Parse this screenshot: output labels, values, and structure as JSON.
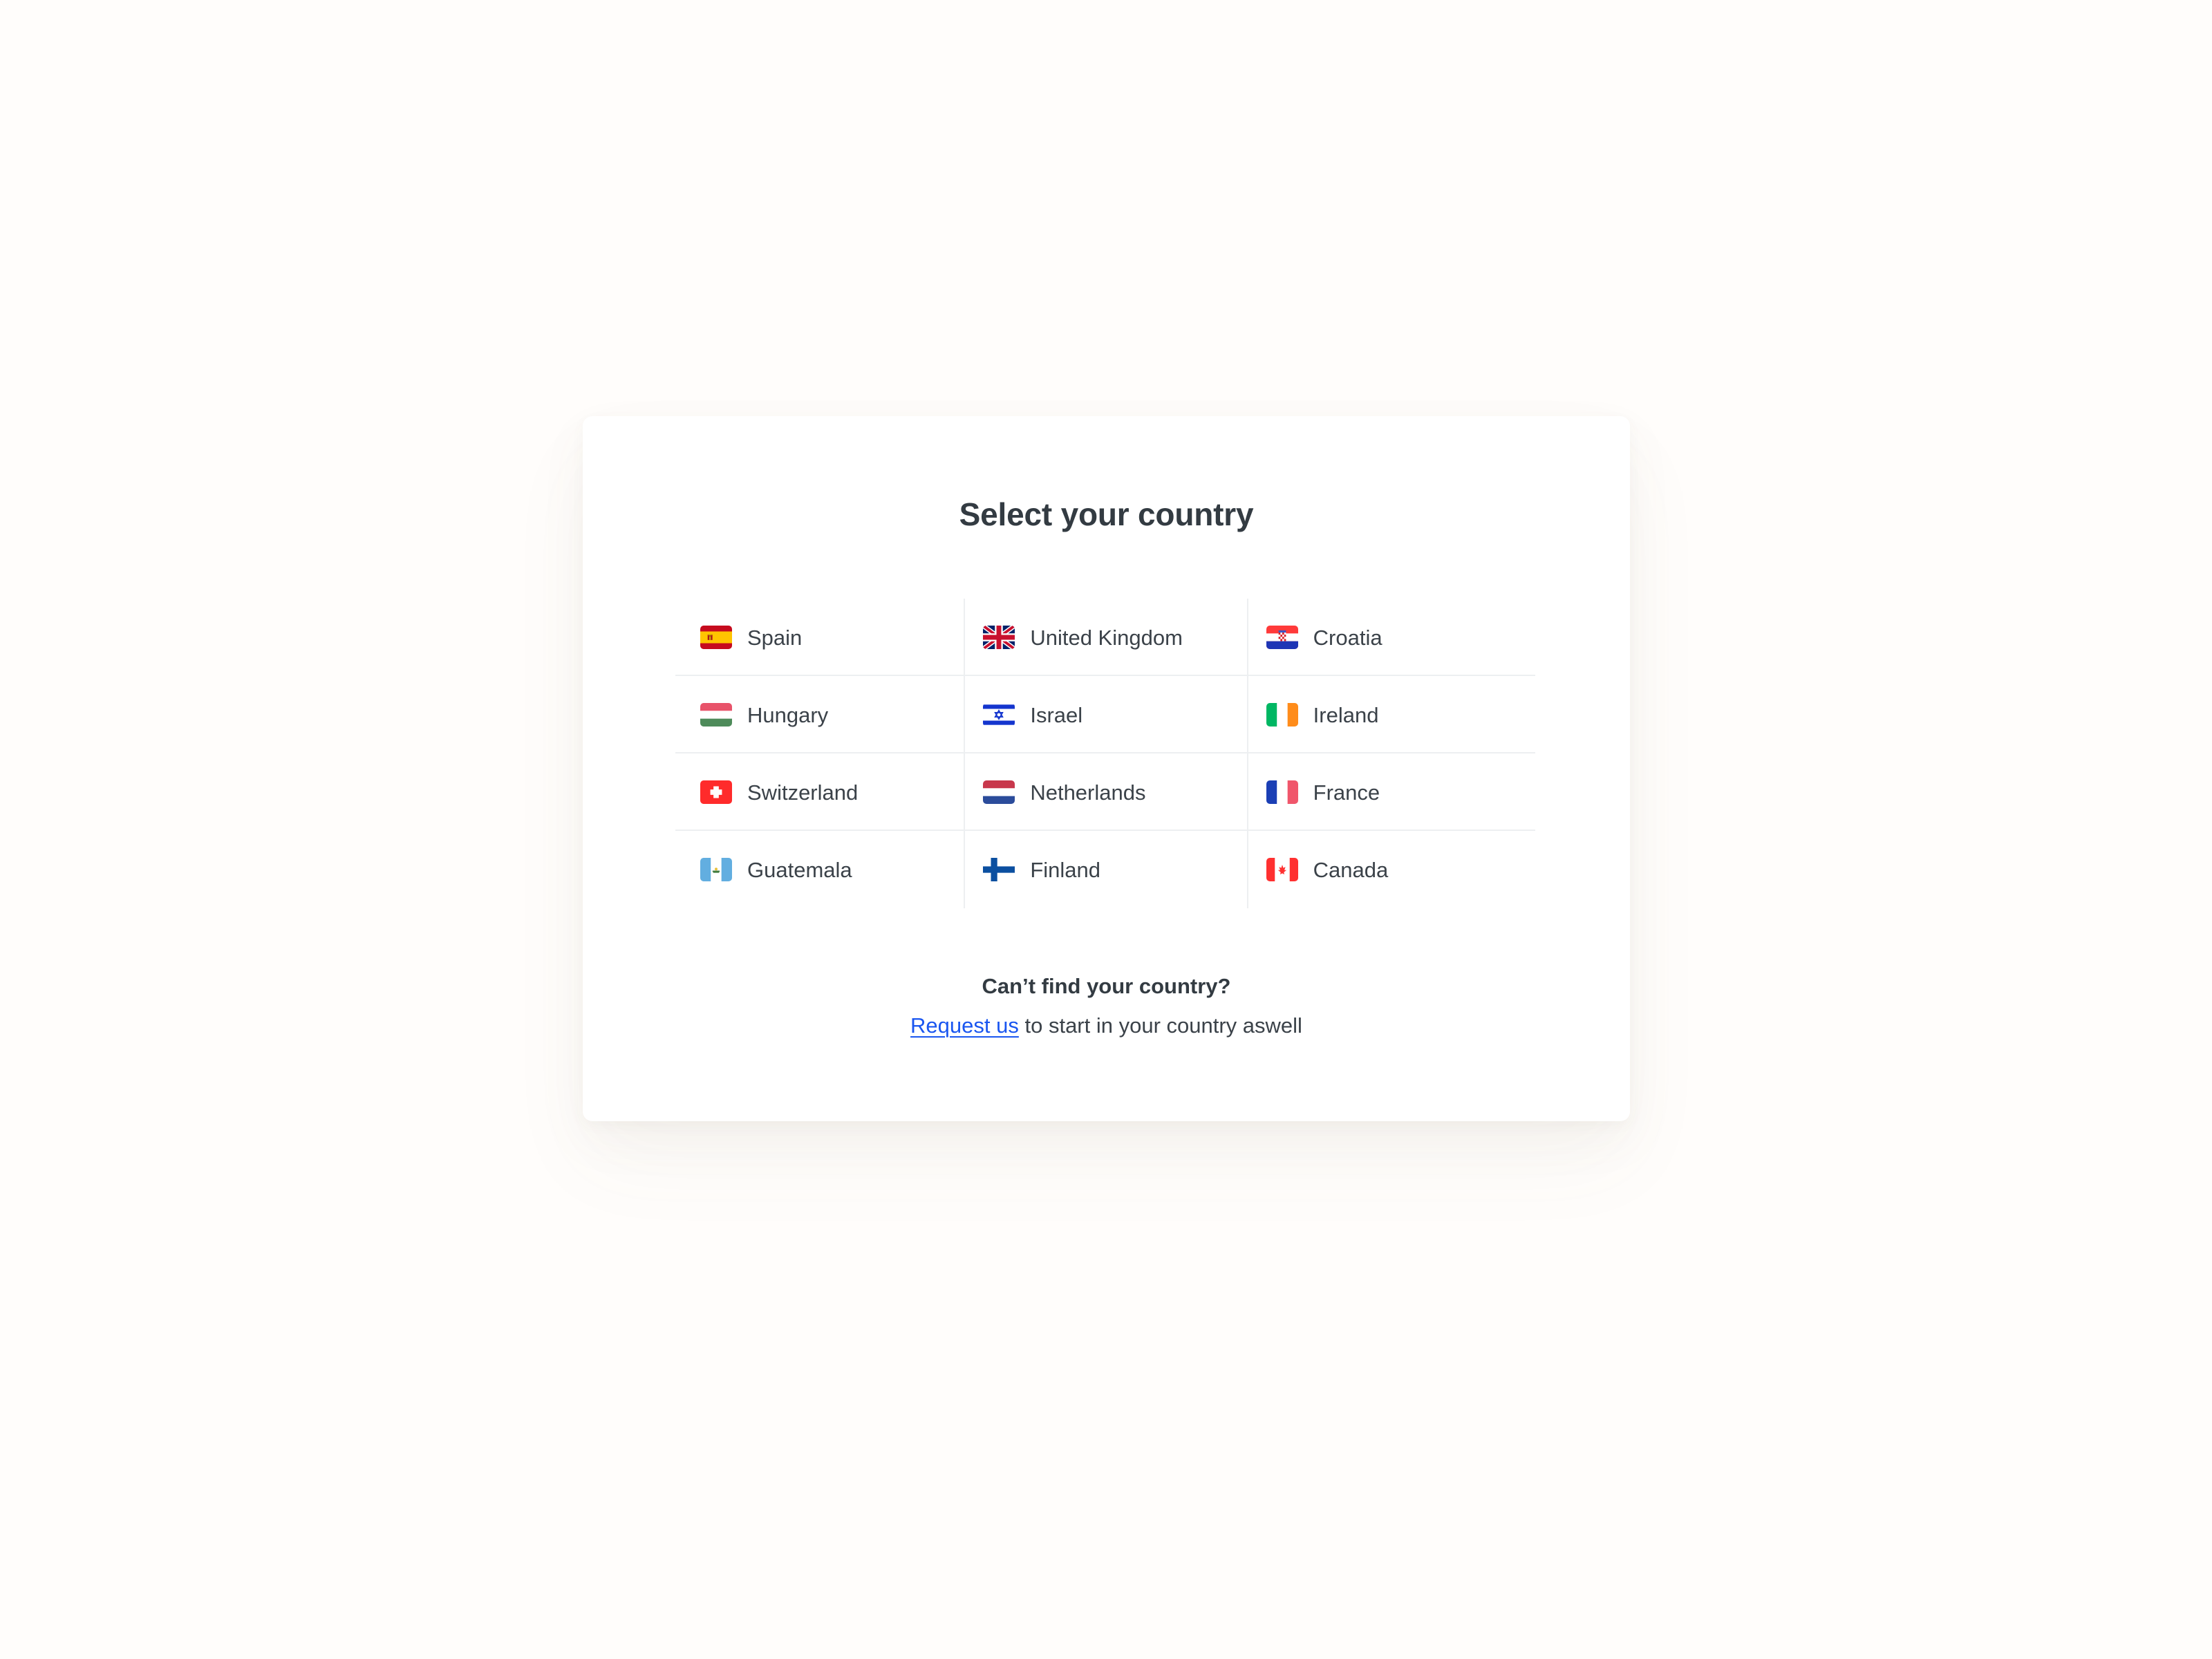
{
  "page": {
    "background_color": "#FFFDFB"
  },
  "card": {
    "background_color": "#FFFFFF",
    "title": "Select your country"
  },
  "grid": {
    "divider_color": "#EDEFF1",
    "columns": 3,
    "countries": [
      {
        "name": "Spain",
        "flag": "flag-spain-icon"
      },
      {
        "name": "United Kingdom",
        "flag": "flag-united-kingdom-icon"
      },
      {
        "name": "Croatia",
        "flag": "flag-croatia-icon"
      },
      {
        "name": "Hungary",
        "flag": "flag-hungary-icon"
      },
      {
        "name": "Israel",
        "flag": "flag-israel-icon"
      },
      {
        "name": "Ireland",
        "flag": "flag-ireland-icon"
      },
      {
        "name": "Switzerland",
        "flag": "flag-switzerland-icon"
      },
      {
        "name": "Netherlands",
        "flag": "flag-netherlands-icon"
      },
      {
        "name": "France",
        "flag": "flag-france-icon"
      },
      {
        "name": "Guatemala",
        "flag": "flag-guatemala-icon"
      },
      {
        "name": "Finland",
        "flag": "flag-finland-icon"
      },
      {
        "name": "Canada",
        "flag": "flag-canada-icon"
      }
    ]
  },
  "footer": {
    "heading": "Can’t find your country?",
    "link_label": "Request us",
    "link_color": "#1A56F0",
    "trailing_text": " to start in your country aswell"
  },
  "colors": {
    "title_text": "#333B42",
    "body_text": "#3B4249",
    "link": "#1A56F0",
    "divider": "#EDEFF1",
    "card_bg": "#FFFFFF",
    "page_bg": "#FFFDFB"
  }
}
